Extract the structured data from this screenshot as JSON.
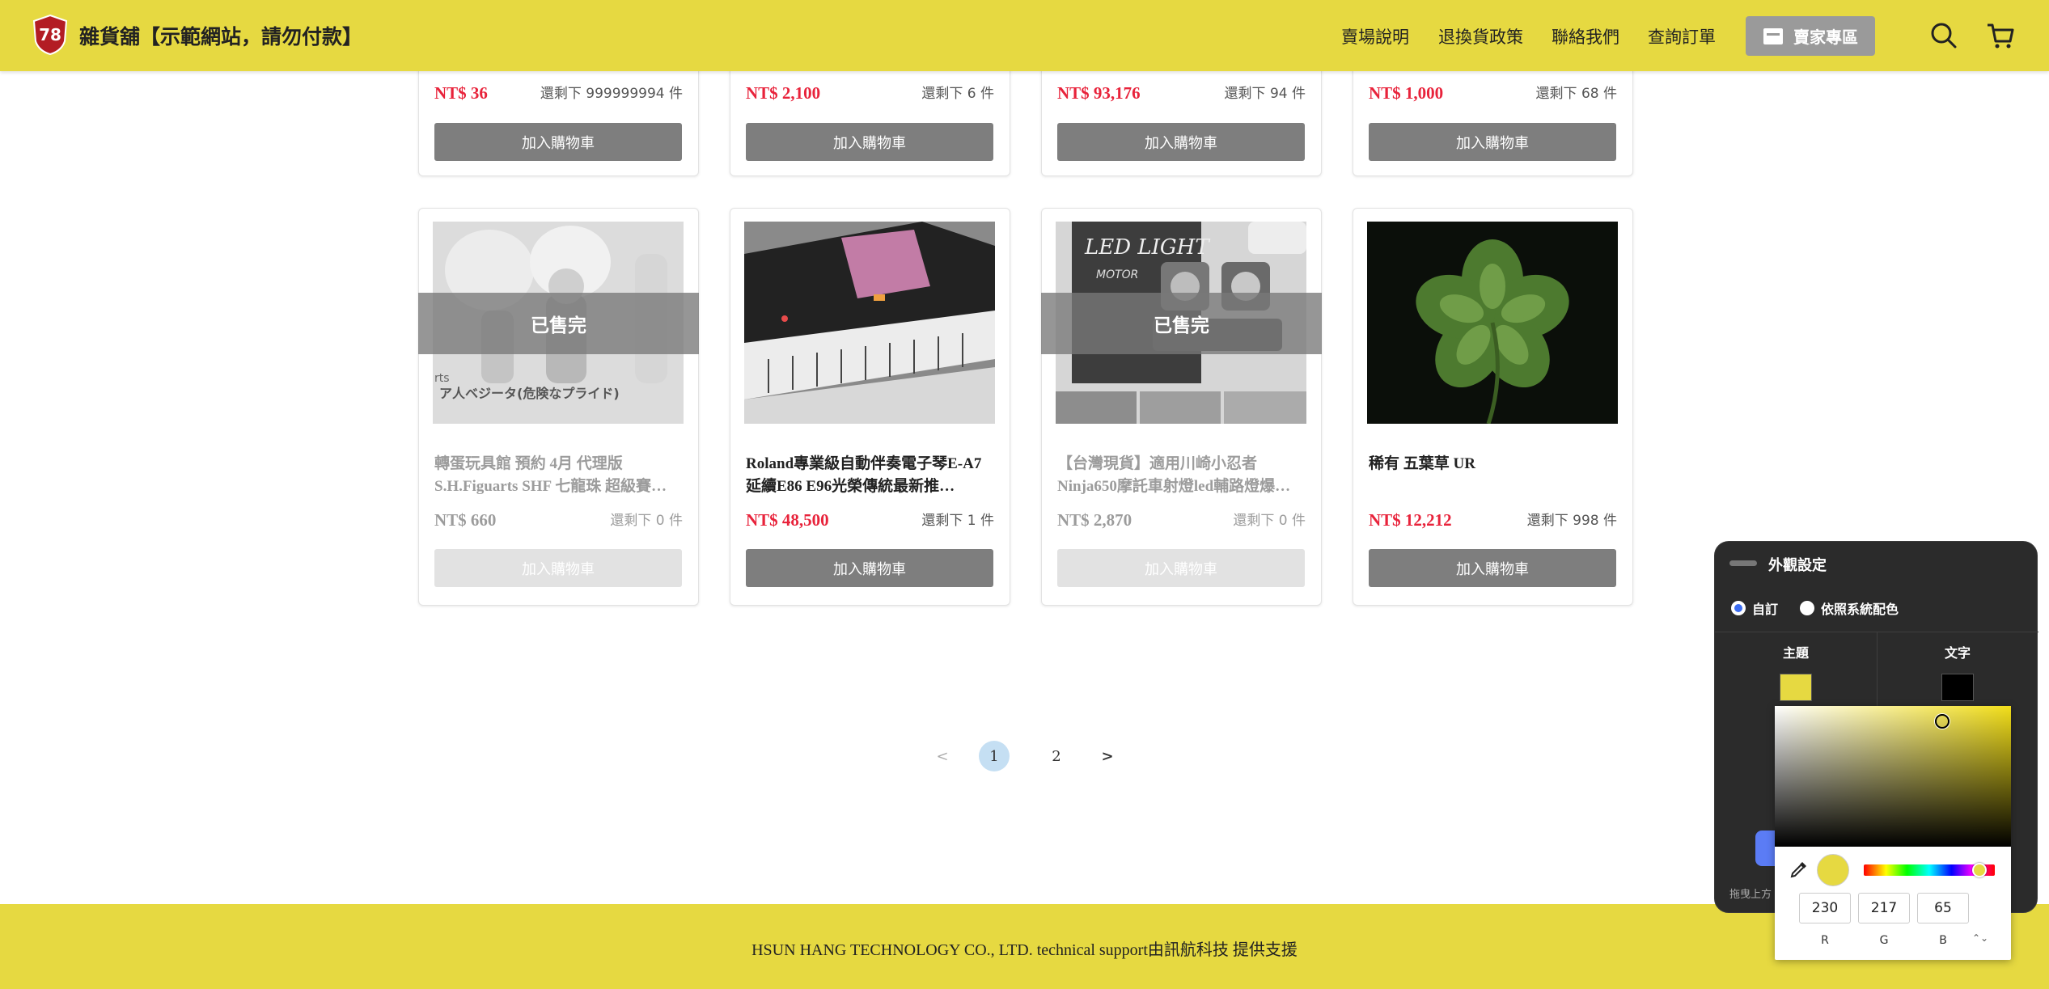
{
  "header": {
    "logo_text": "78",
    "title": "雜貨舖【示範網站，請勿付款】",
    "nav": [
      "賣場說明",
      "退換貨政策",
      "聯絡我們",
      "查詢訂單"
    ],
    "seller_button": "賣家專區"
  },
  "top_row": [
    {
      "price": "NT$ 36",
      "stock": "還剩下 999999994 件",
      "button": "加入購物車"
    },
    {
      "price": "NT$ 2,100",
      "stock": "還剩下 6 件",
      "button": "加入購物車"
    },
    {
      "price": "NT$ 93,176",
      "stock": "還剩下 94 件",
      "button": "加入購物車"
    },
    {
      "price": "NT$ 1,000",
      "stock": "還剩下 68 件",
      "button": "加入購物車"
    }
  ],
  "products": [
    {
      "name": "轉蛋玩具館 預約 4月 代理版 S.H.Figuarts SHF 七龍珠 超級賽…",
      "price": "NT$ 660",
      "stock": "還剩下 0 件",
      "button": "加入購物車",
      "soldout_label": "已售完",
      "image_caption": "ア人ベジータ(危険なプライド)",
      "image_corner": "rts"
    },
    {
      "name": "Roland專業級自動伴奏電子琴E-A7 延續E86 E96光榮傳統最新推…",
      "price": "NT$ 48,500",
      "stock": "還剩下 1 件",
      "button": "加入購物車"
    },
    {
      "name": "【台灣現貨】適用川崎小忍者Ninja650摩託車射燈led輔路燈爆…",
      "price": "NT$ 2,870",
      "stock": "還剩下 0 件",
      "button": "加入購物車",
      "soldout_label": "已售完",
      "image_caption": "LED LIGHT",
      "image_sub": "MOTOR"
    },
    {
      "name": "稀有 五葉草 UR",
      "price": "NT$ 12,212",
      "stock": "還剩下 998 件",
      "button": "加入購物車"
    }
  ],
  "pagination": {
    "prev": "<",
    "pages": [
      "1",
      "2"
    ],
    "current": "1",
    "next": ">"
  },
  "footer": {
    "text": "HSUN HANG TECHNOLOGY CO., LTD. technical support由訊航科技 提供支援"
  },
  "appearance_panel": {
    "title": "外觀設定",
    "options": [
      "自訂",
      "依照系統配色"
    ],
    "selected_option": "自訂",
    "columns": [
      "主題",
      "文字"
    ],
    "theme_color": "#e6d941",
    "text_color": "#000000",
    "hint": "拖曳上方"
  },
  "color_picker": {
    "r": "230",
    "g": "217",
    "b": "65",
    "labels": [
      "R",
      "G",
      "B"
    ],
    "current_color": "#e6d941"
  },
  "colors": {
    "brand": "#e6d941",
    "price": "#e8233b",
    "button": "#7e7e7e"
  }
}
